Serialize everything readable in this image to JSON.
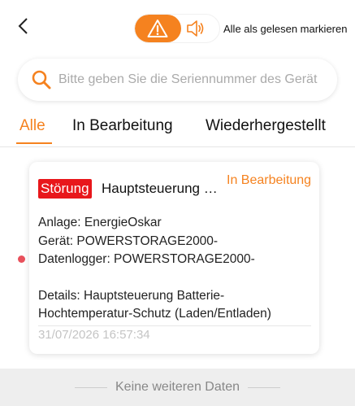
{
  "header": {
    "mark_all_read": "Alle als gelesen markieren",
    "accent_color": "#f5821f"
  },
  "icons": {
    "back": "chevron-left-icon",
    "warning": "warning-icon",
    "sound": "speaker-icon",
    "search": "search-icon"
  },
  "search": {
    "placeholder": "Bitte geben Sie die Seriennummer des Gerät"
  },
  "tabs": [
    {
      "label": "Alle",
      "active": true
    },
    {
      "label": "In Bearbeitung",
      "active": false
    },
    {
      "label": "Wiederhergestellt",
      "active": false
    }
  ],
  "alarms": [
    {
      "badge": "Störung",
      "badge_color": "#e8171b",
      "title": "Hauptsteuerung Batterie-Hochtemperatur-Schutz",
      "status": "In Bearbeitung",
      "plant": "Anlage: EnergieOskar",
      "device": "Gerät: POWERSTORAGE2000-",
      "datalogger": "Datenlogger: POWERSTORAGE2000-",
      "details_line1": "Details: Hauptsteuerung Batterie-",
      "details_line2": "Hochtemperatur-Schutz (Laden/Entladen)",
      "time": "31/07/2026 16:57:34"
    }
  ],
  "footer": {
    "no_more": "Keine weiteren Daten"
  }
}
